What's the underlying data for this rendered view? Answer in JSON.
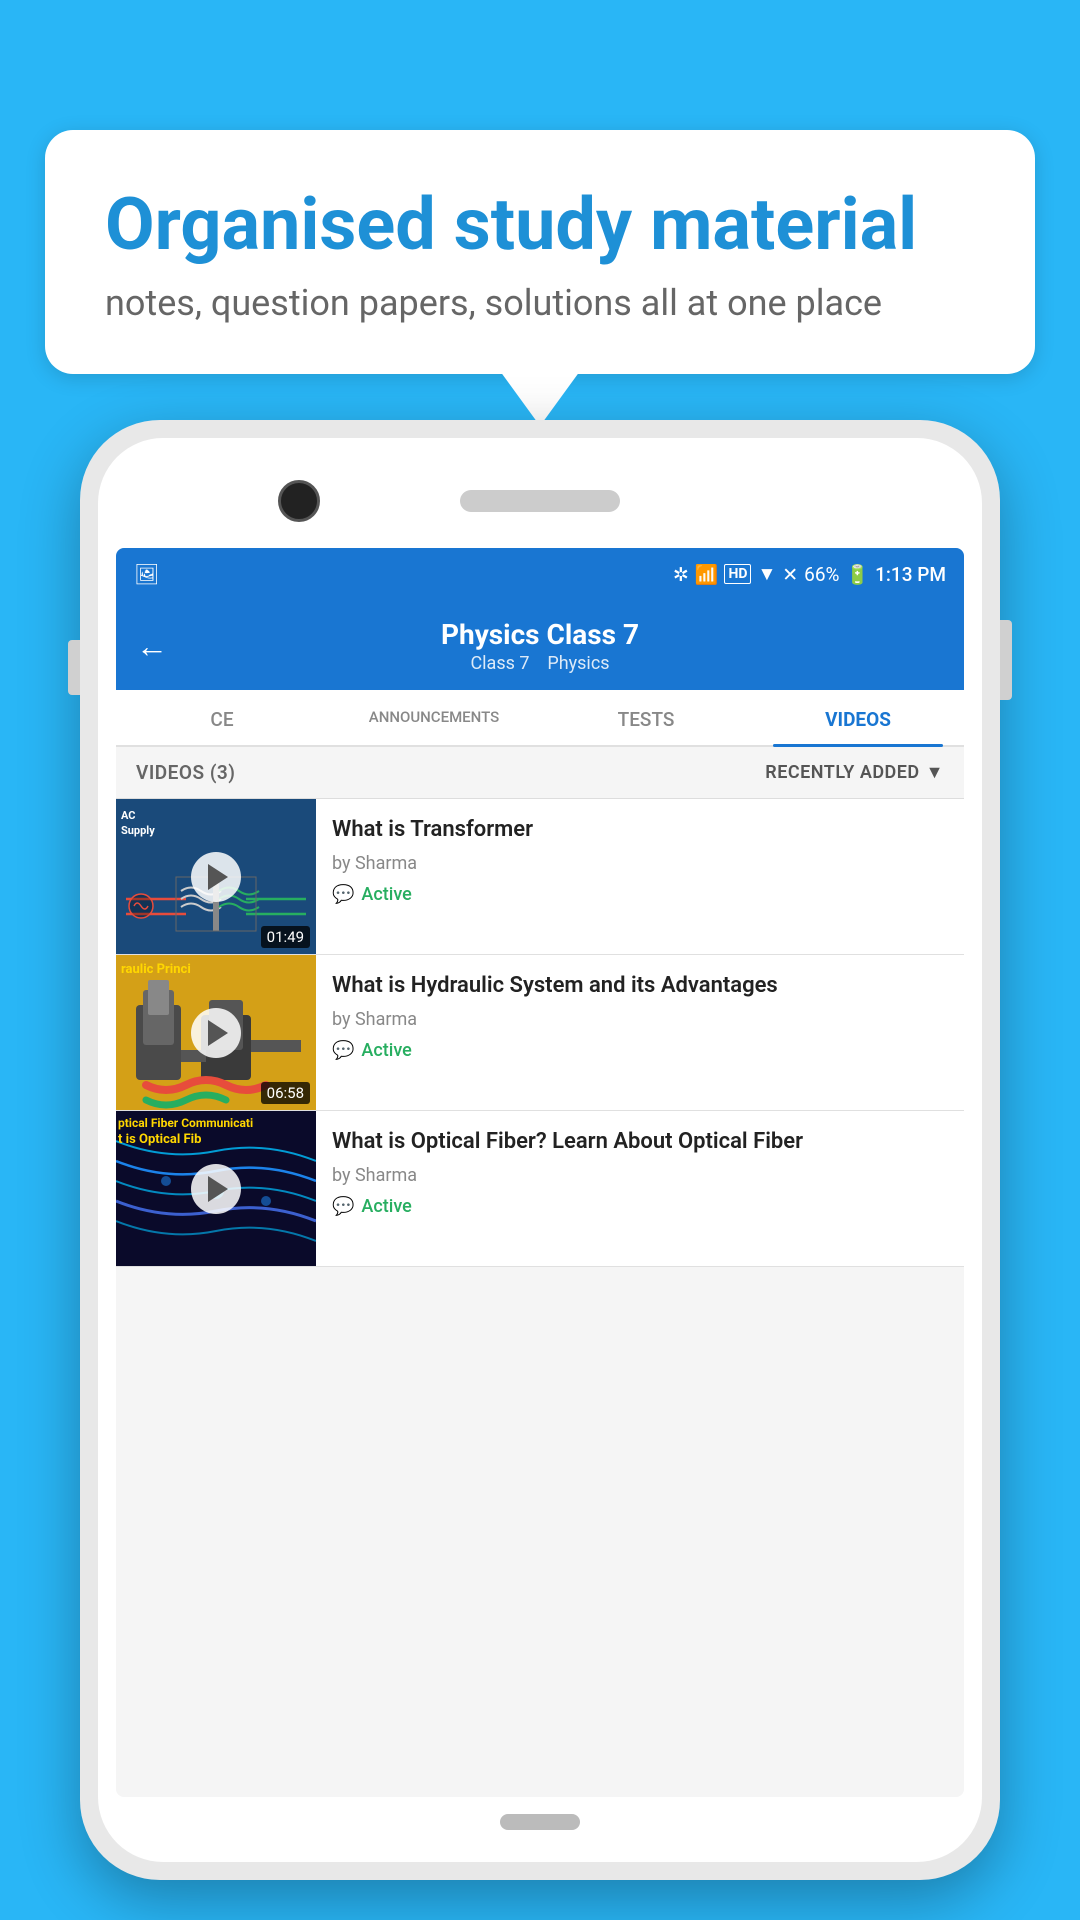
{
  "background_color": "#29b6f6",
  "bubble": {
    "title": "Organised study material",
    "subtitle": "notes, question papers, solutions all at one place"
  },
  "status_bar": {
    "time": "1:13 PM",
    "battery": "66%",
    "signal": "HD"
  },
  "app_bar": {
    "title": "Physics Class 7",
    "subtitle_class": "Class 7",
    "subtitle_subject": "Physics",
    "back_icon": "←"
  },
  "tabs": [
    {
      "id": "ce",
      "label": "CE",
      "active": false
    },
    {
      "id": "announcements",
      "label": "ANNOUNCEMENTS",
      "active": false
    },
    {
      "id": "tests",
      "label": "TESTS",
      "active": false
    },
    {
      "id": "videos",
      "label": "VIDEOS",
      "active": true
    }
  ],
  "filter": {
    "count_label": "VIDEOS (3)",
    "sort_label": "RECENTLY ADDED",
    "sort_icon": "▼"
  },
  "videos": [
    {
      "id": 1,
      "title": "What is  Transformer",
      "author": "by Sharma",
      "status": "Active",
      "duration": "01:49",
      "thumb_type": "transformer"
    },
    {
      "id": 2,
      "title": "What is Hydraulic System and its Advantages",
      "author": "by Sharma",
      "status": "Active",
      "duration": "06:58",
      "thumb_type": "hydraulic"
    },
    {
      "id": 3,
      "title": "What is Optical Fiber? Learn About Optical Fiber",
      "author": "by Sharma",
      "status": "Active",
      "duration": "",
      "thumb_type": "fiber"
    }
  ]
}
